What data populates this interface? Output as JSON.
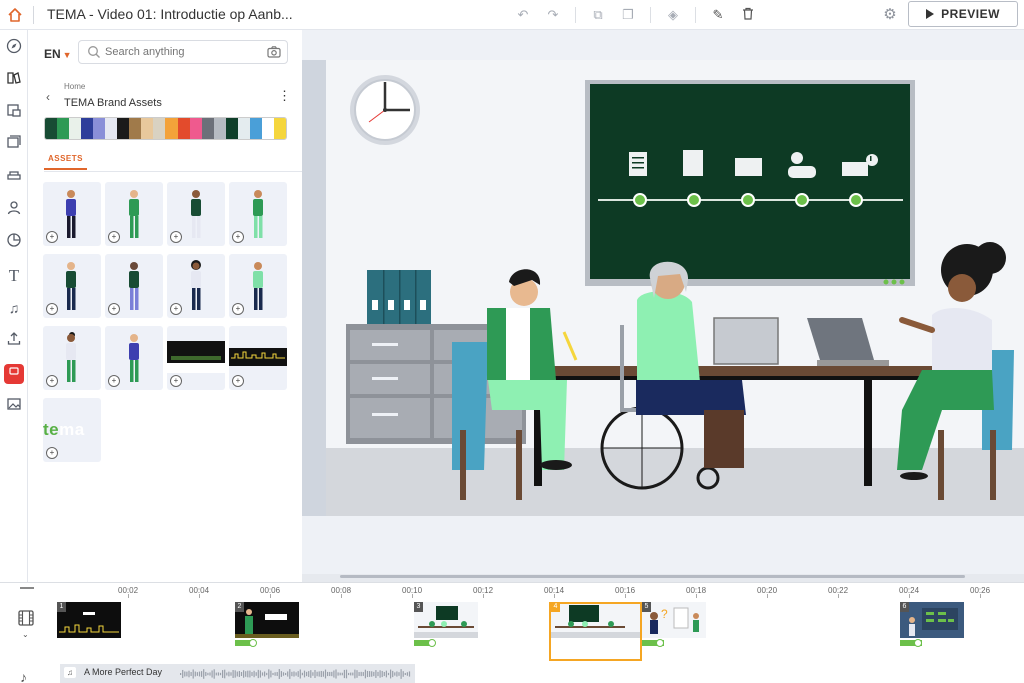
{
  "app": {
    "title": "TEMA - Video 01: Introductie op Aanb..."
  },
  "toolbar": {
    "preview_label": "PREVIEW",
    "tools": [
      "undo-icon",
      "redo-icon",
      "copy-icon",
      "duplicate-icon",
      "layers-icon",
      "magic-icon",
      "trash-icon"
    ]
  },
  "panel": {
    "language": "EN",
    "search_placeholder": "Search anything",
    "breadcrumb_home": "Home",
    "breadcrumb_title": "TEMA Brand Assets",
    "tab_assets": "ASSETS",
    "palette": [
      "#184c34",
      "#2e9a55",
      "#e9f1ea",
      "#2e3e9a",
      "#8a8fd8",
      "#e6e8f2",
      "#1a1a1a",
      "#a07a4a",
      "#e8c89c",
      "#d9d2c2",
      "#f3a23a",
      "#e34b2c",
      "#ef5a8e",
      "#6c7079",
      "#b6bbc2",
      "#0f3f2a",
      "#e4ecef",
      "#4a9fd8",
      "#ffffff",
      "#f5d63d"
    ],
    "logo_tile_text_a": "te",
    "logo_tile_text_b": "ma"
  },
  "timeline": {
    "ruler": [
      "00:02",
      "00:04",
      "00:06",
      "00:08",
      "00:10",
      "00:12",
      "00:14",
      "00:16",
      "00:18",
      "00:20",
      "00:22",
      "00:24",
      "00:26"
    ],
    "scenes": [
      {
        "num": "1"
      },
      {
        "num": "2"
      },
      {
        "num": "3"
      },
      {
        "num": "4"
      },
      {
        "num": "5"
      },
      {
        "num": "6"
      }
    ],
    "audio_title": "A More Perfect Day"
  }
}
